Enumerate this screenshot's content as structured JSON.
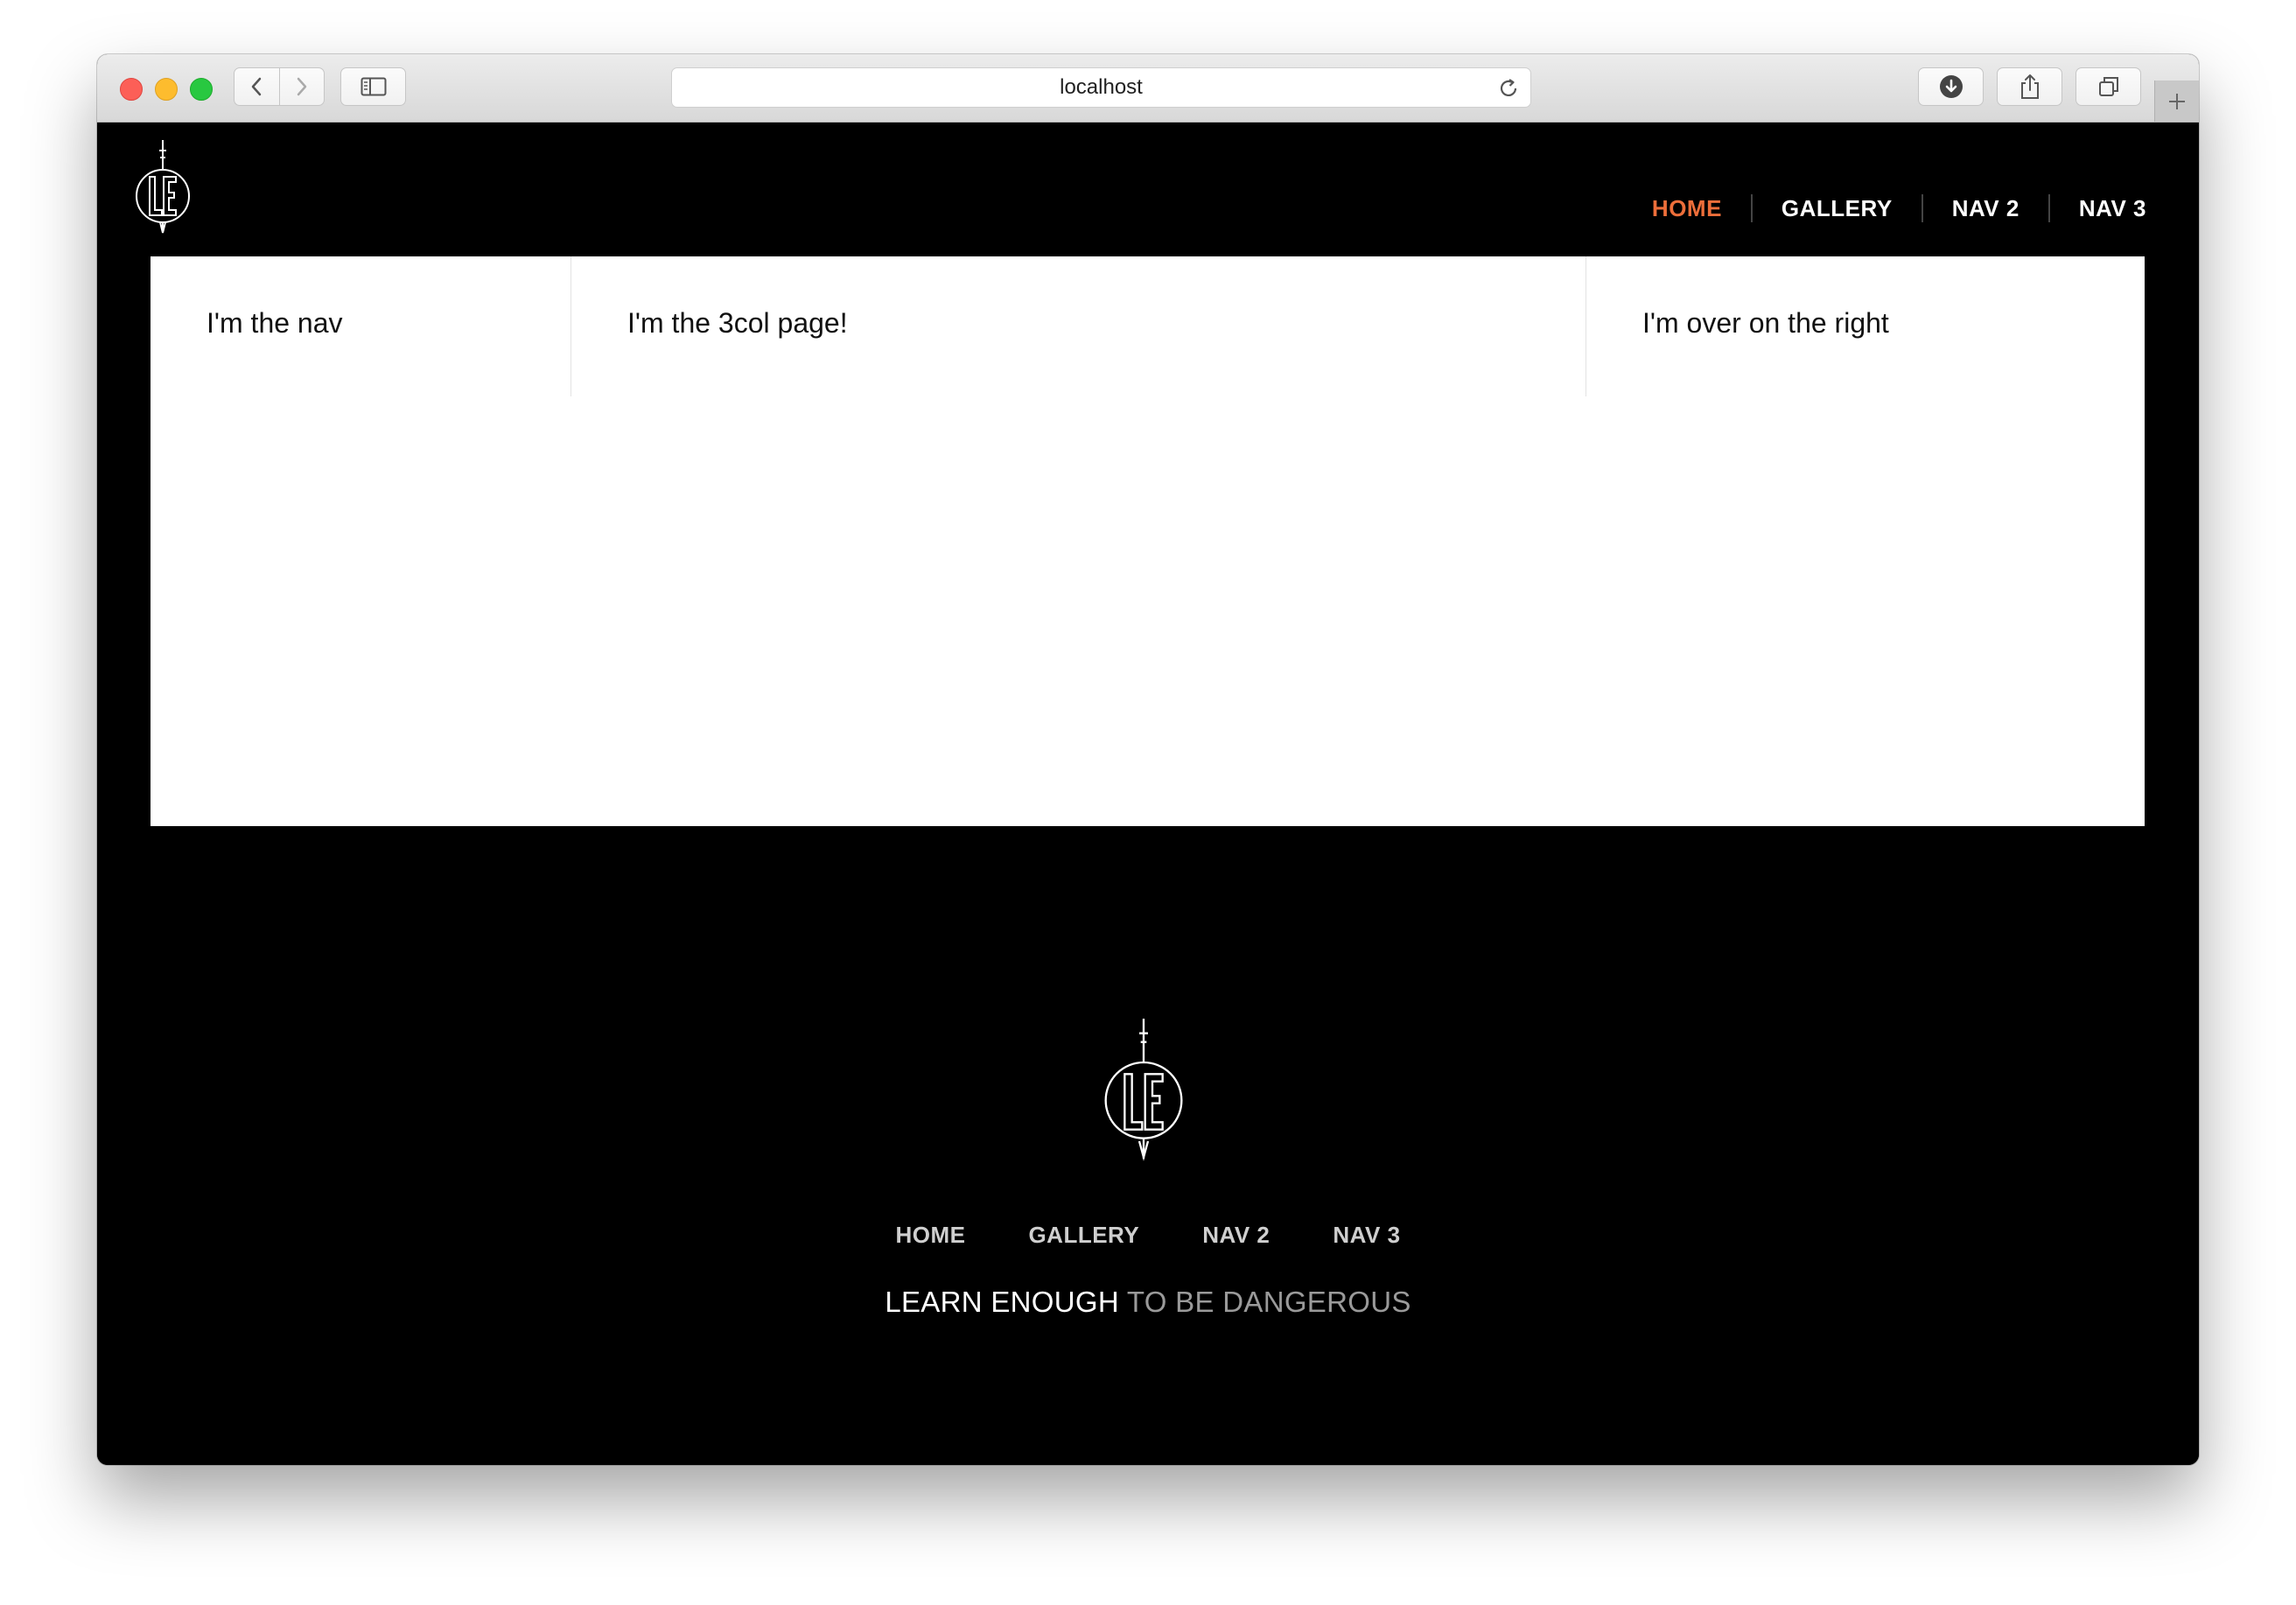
{
  "browser": {
    "url": "localhost",
    "icons": {
      "back": "chevron-left-icon",
      "forward": "chevron-right-icon",
      "sidebar": "sidebar-icon",
      "reload": "reload-icon",
      "downloads": "download-icon",
      "share": "share-icon",
      "tabs": "tabs-overview-icon",
      "new_tab": "plus-icon"
    }
  },
  "header": {
    "logo": "le-logo",
    "nav": [
      {
        "label": "HOME",
        "active": true
      },
      {
        "label": "GALLERY",
        "active": false
      },
      {
        "label": "NAV 2",
        "active": false
      },
      {
        "label": "NAV 3",
        "active": false
      }
    ],
    "accent_color": "#ed6e3a"
  },
  "main": {
    "left": "I'm the nav",
    "center": "I'm the 3col page!",
    "right": "I'm over on the right"
  },
  "footer": {
    "logo": "le-logo",
    "nav": [
      "HOME",
      "GALLERY",
      "NAV 2",
      "NAV 3"
    ],
    "tagline_strong": "LEARN ENOUGH",
    "tagline_rest": "TO BE DANGEROUS"
  }
}
